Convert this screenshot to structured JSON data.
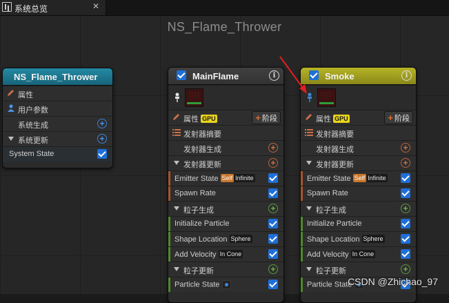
{
  "tab": {
    "icon": "graph-tab-icon",
    "label": "系统总览",
    "close": "✕"
  },
  "graph": {
    "title": "NS_Flame_Thrower"
  },
  "system_node": {
    "title": "NS_Flame_Thrower",
    "header_color": "#1f7f99",
    "rows": [
      {
        "label": "属性",
        "icon": "pencil-icon"
      },
      {
        "label": "用户参数",
        "icon": "person-icon"
      },
      {
        "label": "系统生成",
        "action": "+"
      },
      {
        "label": "系统更新",
        "action": "+"
      },
      {
        "label": "System State",
        "checked": true
      }
    ]
  },
  "mainflame": {
    "title": "MainFlame",
    "header_color": "#3a3a3a",
    "properties_label": "属性",
    "gpu_badge": "GPU",
    "stage_label": "阶段",
    "stage_plus": "+",
    "summary": "发射器摘要",
    "emitter_spawn": "发射器生成",
    "emitter_update": "发射器更新",
    "emitter_state": {
      "label": "Emitter State",
      "badge1": "Self",
      "badge2": "Infinite"
    },
    "spawn_rate": "Spawn Rate",
    "particle_spawn": "粒子生成",
    "initialize_particle": "Initialize Particle",
    "shape_location": {
      "label": "Shape Location",
      "badge": "Sphere"
    },
    "add_velocity": {
      "label": "Add Velocity",
      "badge": "In Cone"
    },
    "particle_update": "粒子更新",
    "particle_state": "Particle State"
  },
  "smoke": {
    "title": "Smoke",
    "header_color": "#9c9a1e",
    "properties_label": "属性",
    "gpu_badge": "GPU",
    "stage_label": "阶段",
    "stage_plus": "+",
    "summary": "发射器摘要",
    "emitter_spawn": "发射器生成",
    "emitter_update": "发射器更新",
    "emitter_state": {
      "label": "Emitter State",
      "badge1": "Self",
      "badge2": "Infinite"
    },
    "spawn_rate": "Spawn Rate",
    "particle_spawn": "粒子生成",
    "initialize_particle": "Initialize Particle",
    "shape_location": {
      "label": "Shape Location",
      "badge": "Sphere"
    },
    "add_velocity": {
      "label": "Add Velocity",
      "badge": "In Cone"
    },
    "particle_update": "粒子更新",
    "particle_state": "Particle State"
  },
  "watermark": "CSDN @Zhichao_97"
}
